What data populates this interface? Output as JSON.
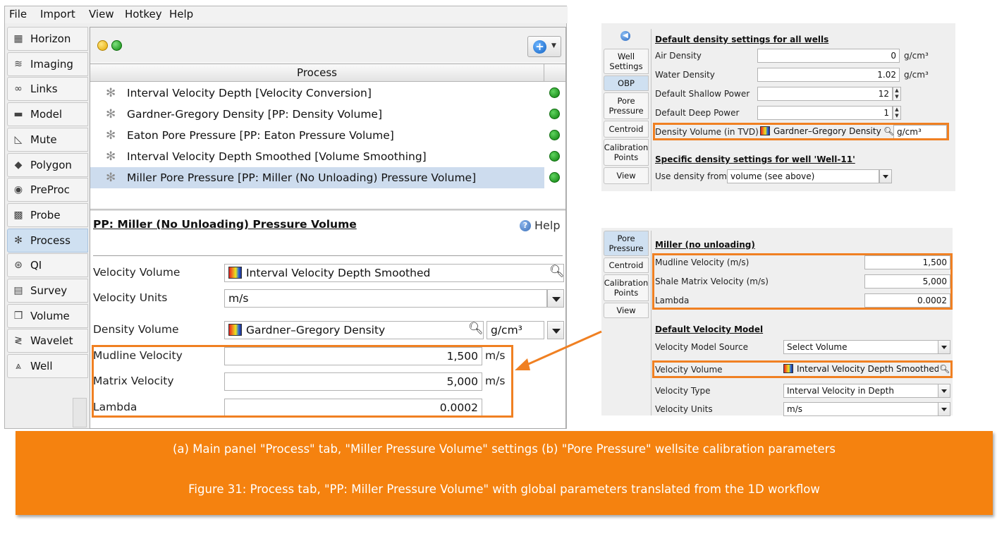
{
  "menu": [
    "File",
    "Import",
    "View",
    "Hotkey",
    "Help"
  ],
  "sidebar": {
    "items": [
      {
        "label": "Horizon",
        "icon": "grid-icon",
        "glyph": "▦"
      },
      {
        "label": "Imaging",
        "icon": "wave-lines-icon",
        "glyph": "≋"
      },
      {
        "label": "Links",
        "icon": "chain-link-icon",
        "glyph": "∞"
      },
      {
        "label": "Model",
        "icon": "model-block-icon",
        "glyph": "▬"
      },
      {
        "label": "Mute",
        "icon": "mute-slope-icon",
        "glyph": "◺"
      },
      {
        "label": "Polygon",
        "icon": "polygon-icon",
        "glyph": "◆"
      },
      {
        "label": "PreProc",
        "icon": "preproc-cube-icon",
        "glyph": "◉"
      },
      {
        "label": "Probe",
        "icon": "probe-icon",
        "glyph": "▩"
      },
      {
        "label": "Process",
        "icon": "gear-icon",
        "glyph": "✻"
      },
      {
        "label": "QI",
        "icon": "qi-circles-icon",
        "glyph": "⊛"
      },
      {
        "label": "Survey",
        "icon": "survey-icon",
        "glyph": "▤"
      },
      {
        "label": "Volume",
        "icon": "volume-cube-icon",
        "glyph": "❒"
      },
      {
        "label": "Wavelet",
        "icon": "wavelet-icon",
        "glyph": "≷"
      },
      {
        "label": "Well",
        "icon": "well-derrick-icon",
        "glyph": "⩓"
      }
    ],
    "active": "Process"
  },
  "process_table": {
    "header": "Process",
    "rows": [
      "Interval Velocity Depth [Velocity Conversion]",
      "Gardner-Gregory Density [PP: Density Volume]",
      "Eaton Pore Pressure [PP: Eaton Pressure Volume]",
      "Interval Velocity Depth Smoothed [Volume Smoothing]",
      "Miller Pore Pressure [PP: Miller (No Unloading) Pressure Volume]"
    ],
    "selected_index": 4
  },
  "detail": {
    "title": "PP: Miller (No Unloading) Pressure Volume",
    "help_label": "Help",
    "velocity_volume_label": "Velocity Volume",
    "velocity_volume_value": "Interval Velocity Depth Smoothed",
    "velocity_units_label": "Velocity Units",
    "velocity_units_value": "m/s",
    "density_volume_label": "Density Volume",
    "density_volume_value": "Gardner–Gregory Density",
    "density_unit_value": "g/cm³",
    "mudline_label": "Mudline Velocity",
    "mudline_value": "1,500",
    "matrix_label": "Matrix Velocity",
    "matrix_value": "5,000",
    "lambda_label": "Lambda",
    "lambda_value": "0.0002",
    "unit_ms": "m/s"
  },
  "panel_b_top": {
    "tabs": [
      "Well Settings",
      "OBP",
      "Pore Pressure",
      "Centroid",
      "Calibration Points",
      "View"
    ],
    "section1": "Default density settings for all wells",
    "air_density_label": "Air Density",
    "air_density_value": "0",
    "water_density_label": "Water Density",
    "water_density_value": "1.02",
    "unit_gcm3": "g/cm³",
    "shallow_power_label": "Default Shallow Power",
    "shallow_power_value": "12",
    "deep_power_label": "Default Deep Power",
    "deep_power_value": "1",
    "density_volume_label": "Density Volume (in TVD)",
    "density_volume_value": "Gardner–Gregory Density",
    "density_volume_unit": "g/cm³",
    "section2": "Specific density settings for well 'Well-11'",
    "use_density_label": "Use density from",
    "use_density_value": "volume (see above)"
  },
  "panel_b_bottom": {
    "tabs": [
      "Pore Pressure",
      "Centroid",
      "Calibration Points",
      "View"
    ],
    "section1": "Miller (no unloading)",
    "mudline_label": "Mudline Velocity (m/s)",
    "mudline_value": "1,500",
    "shale_label": "Shale Matrix Velocity (m/s)",
    "shale_value": "5,000",
    "lambda_label": "Lambda",
    "lambda_value": "0.0002",
    "section2": "Default Velocity Model",
    "source_label": "Velocity Model Source",
    "source_value": "Select Volume",
    "vol_label": "Velocity Volume",
    "vol_value": "Interval Velocity Depth Smoothed",
    "type_label": "Velocity Type",
    "type_value": "Interval Velocity in Depth",
    "units_label": "Velocity Units",
    "units_value": "m/s"
  },
  "caption": {
    "line1": "(a) Main panel \"Process\" tab, \"Miller Pressure Volume\" settings   (b) \"Pore Pressure\" wellsite calibration parameters",
    "line2": "Figure 31: Process tab, \"PP: Miller Pressure Volume\" with global parameters translated from the 1D workflow"
  },
  "colors": {
    "highlight_orange": "#f08022",
    "caption_orange": "#f5820f",
    "selection_blue": "#cddcee",
    "status_green": "#0d7f0d"
  }
}
